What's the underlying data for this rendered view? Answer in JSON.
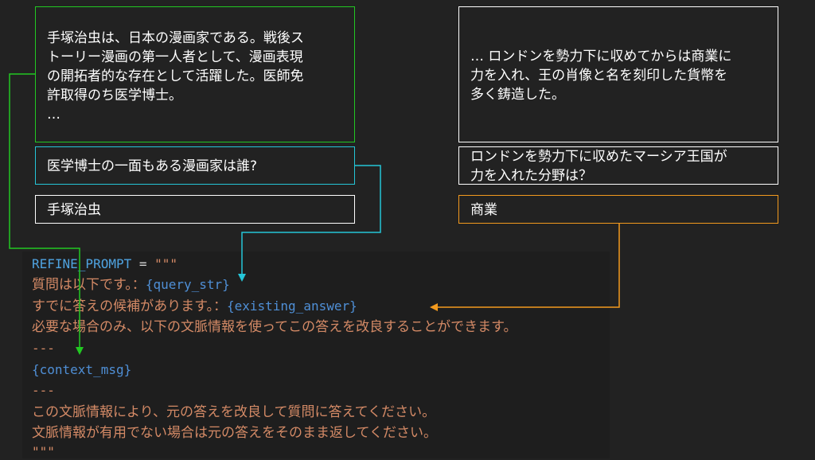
{
  "left_example": {
    "context": "手塚治虫は、日本の漫画家である。戦後ス\nトーリー漫画の第一人者として、漫画表現\nの開拓者的な存在として活躍した。医師免\n許取得のち医学博士。\n…",
    "question": "医学博士の一面もある漫画家は誰?",
    "answer": "手塚治虫"
  },
  "right_example": {
    "context": "… ロンドンを勢力下に収めてからは商業に\n力を入れ、王の肖像と名を刻印した貨幣を\n多く鋳造した。",
    "question": "ロンドンを勢力下に収めたマーシア王国が\n力を入れた分野は？",
    "answer": "商業"
  },
  "code": {
    "var_name": "REFINE_PROMPT",
    "assign": " = ",
    "quotes_open": "\"\"\"",
    "line2_text": "質問は以下です。：",
    "line2_var": "{query_str}",
    "line3_text": "すでに答えの候補があります。：",
    "line3_var": "{existing_answer}",
    "line4_text": "必要な場合のみ、以下の文脈情報を使ってこの答えを改良することができます。",
    "separator1": "---",
    "context_var": "{context_msg}",
    "separator2": "---",
    "line8_text": "この文脈情報により、元の答えを改良して質問に答えてください。",
    "line9_text": "文脈情報が有用でない場合は元の答えをそのまま返してください。",
    "quotes_close": "\"\"\""
  },
  "colors": {
    "background": "#222222",
    "context_arrow": "#22c822",
    "question_arrow": "#25c6d8",
    "answer_arrow": "#f39a1e",
    "code_keyword": "#4fa3e0",
    "code_string": "#d48a66"
  }
}
